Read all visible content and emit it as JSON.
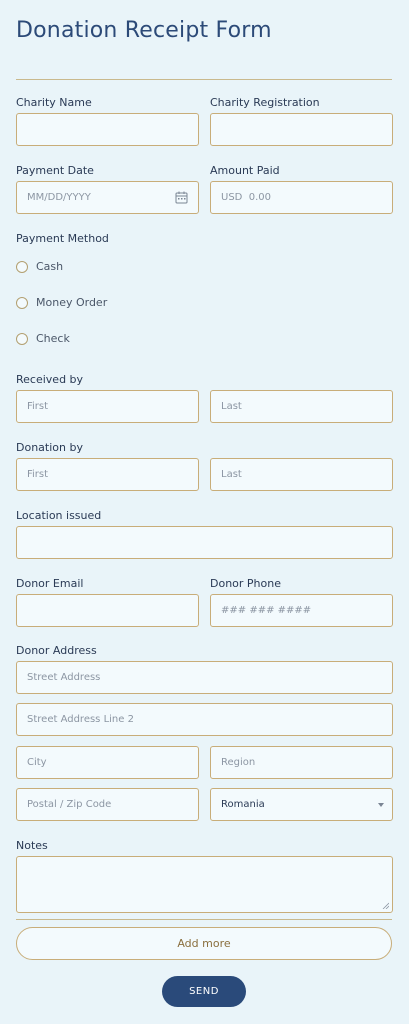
{
  "title": "Donation Receipt Form",
  "charity_name": {
    "label": "Charity Name",
    "value": ""
  },
  "charity_registration": {
    "label": "Charity Registration",
    "value": ""
  },
  "payment_date": {
    "label": "Payment Date",
    "placeholder": "MM/DD/YYYY"
  },
  "amount_paid": {
    "label": "Amount Paid",
    "placeholder": "USD  0.00"
  },
  "payment_method": {
    "label": "Payment Method",
    "options": [
      "Cash",
      "Money Order",
      "Check"
    ]
  },
  "received_by": {
    "label": "Received by",
    "first_placeholder": "First",
    "last_placeholder": "Last"
  },
  "donation_by": {
    "label": "Donation by",
    "first_placeholder": "First",
    "last_placeholder": "Last"
  },
  "location_issued": {
    "label": "Location issued"
  },
  "donor_email": {
    "label": "Donor Email"
  },
  "donor_phone": {
    "label": "Donor Phone",
    "placeholder": "### ### ####"
  },
  "donor_address": {
    "label": "Donor Address",
    "street_placeholder": "Street Address",
    "street2_placeholder": "Street Address Line 2",
    "city_placeholder": "City",
    "region_placeholder": "Region",
    "postal_placeholder": "Postal / Zip Code",
    "country_value": "Romania"
  },
  "notes": {
    "label": "Notes"
  },
  "add_more_label": "Add more",
  "send_label": "SEND",
  "colors": {
    "background": "#e9f4f9",
    "border": "#c8ad79",
    "title": "#2c4a78",
    "send_button": "#2a4a7a"
  }
}
